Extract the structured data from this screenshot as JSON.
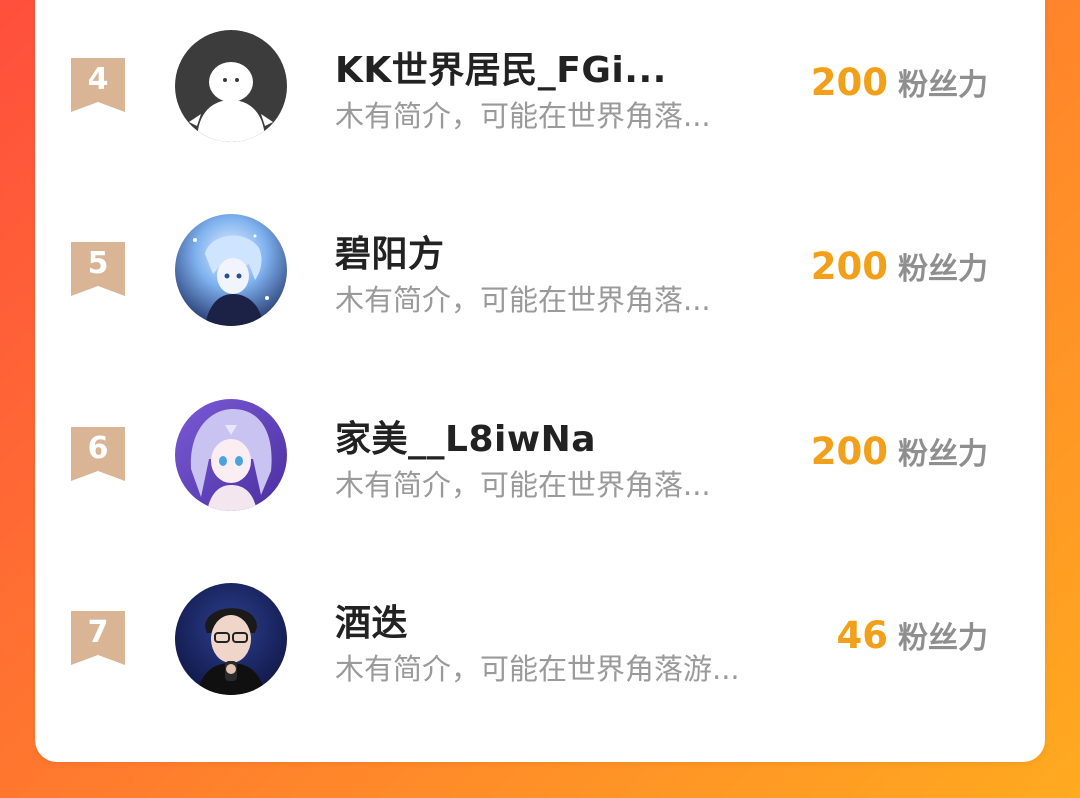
{
  "ranking": {
    "items": [
      {
        "rank": "4",
        "name": "KK世界居民_FGi...",
        "bio": "木有简介，可能在世界角落...",
        "fans": "200",
        "fans_label": "粉丝力",
        "avatar": "default-avatar-icon"
      },
      {
        "rank": "5",
        "name": "碧阳方",
        "bio": "木有简介，可能在世界角落...",
        "fans": "200",
        "fans_label": "粉丝力",
        "avatar": "anime-boy-avatar"
      },
      {
        "rank": "6",
        "name": "家美__L8iwNa",
        "bio": "木有简介，可能在世界角落...",
        "fans": "200",
        "fans_label": "粉丝力",
        "avatar": "anime-girl-avatar"
      },
      {
        "rank": "7",
        "name": "酒迭",
        "bio": "木有简介，可能在世界角落游...",
        "fans": "46",
        "fans_label": "粉丝力",
        "avatar": "photo-avatar"
      }
    ]
  },
  "colors": {
    "fans_number": "#f2a01a",
    "rank_ribbon": "#d9b596",
    "background_start": "#ff4f3d",
    "background_end": "#ffaa1f"
  }
}
